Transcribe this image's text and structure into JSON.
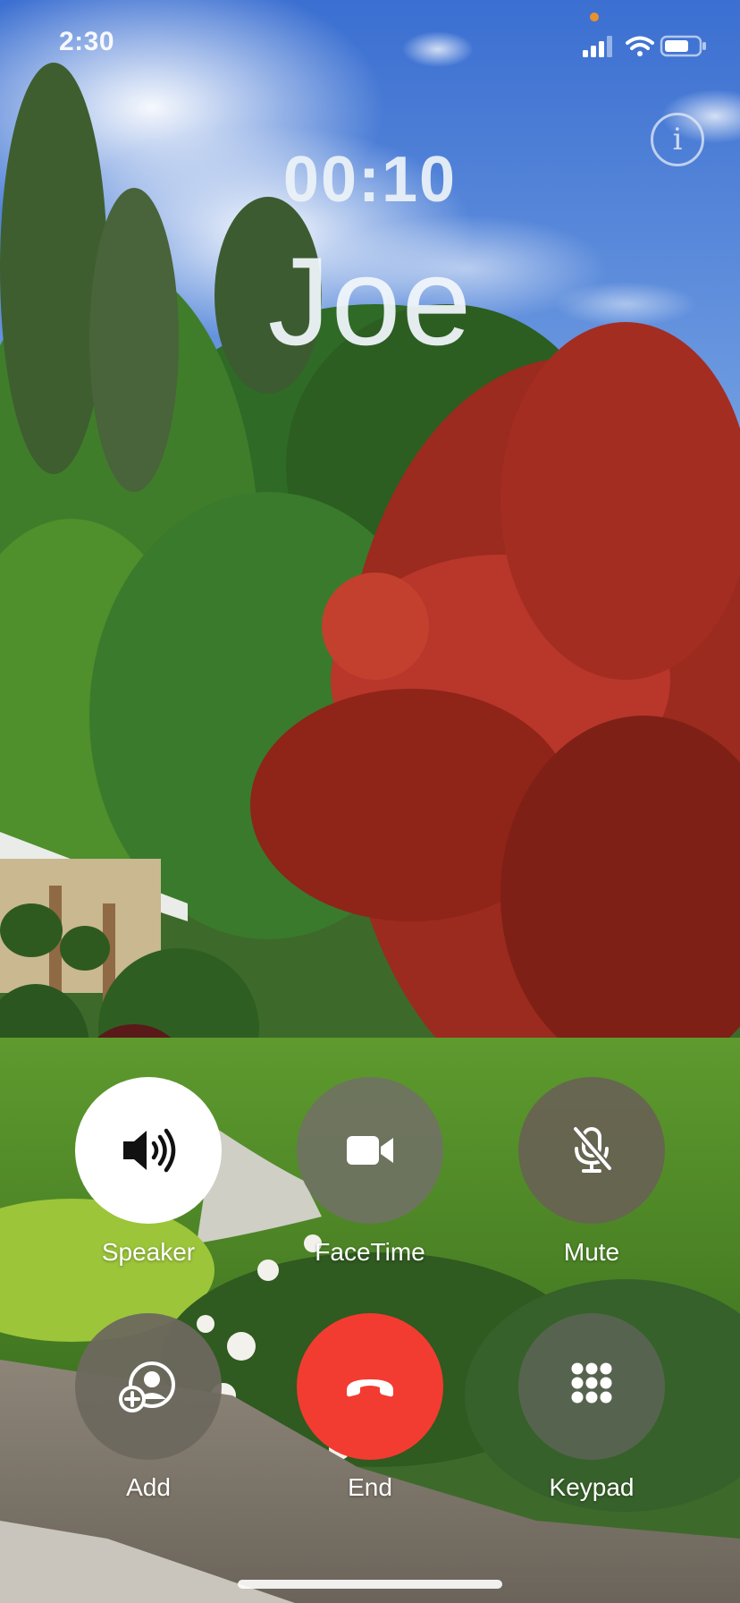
{
  "status_bar": {
    "time": "2:30",
    "signal_icon": "cellular-signal-icon",
    "wifi_icon": "wifi-icon",
    "battery_icon": "battery-icon"
  },
  "call": {
    "duration": "00:10",
    "caller_name": "Joe",
    "info_icon": "info-icon"
  },
  "buttons": {
    "speaker": {
      "label": "Speaker",
      "icon": "speaker-icon",
      "active": true
    },
    "facetime": {
      "label": "FaceTime",
      "icon": "video-camera-icon",
      "active": false
    },
    "mute": {
      "label": "Mute",
      "icon": "microphone-slash-icon",
      "active": false
    },
    "add": {
      "label": "Add",
      "icon": "add-person-icon",
      "active": false
    },
    "end": {
      "label": "End",
      "icon": "phone-hangup-icon",
      "active": false
    },
    "keypad": {
      "label": "Keypad",
      "icon": "keypad-icon",
      "active": false
    }
  },
  "colors": {
    "end_button": "#F23C31",
    "active_button": "#FFFFFF",
    "inactive_button": "#6F7263"
  }
}
